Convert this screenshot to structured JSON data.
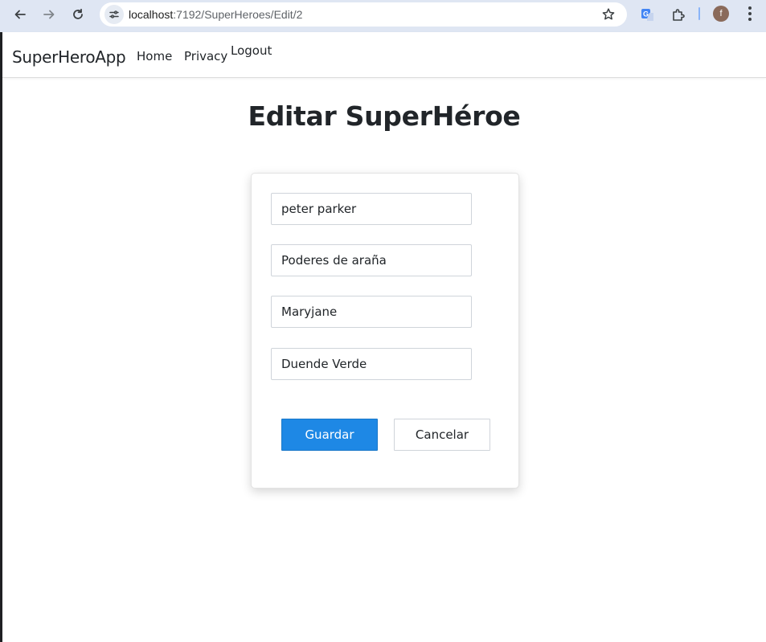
{
  "browser": {
    "url_host": "localhost",
    "url_path": ":7192/SuperHeroes/Edit/2",
    "profile_initial": "f",
    "icons": [
      "back-arrow-icon",
      "forward-arrow-icon",
      "reload-icon",
      "site-info-icon",
      "bookmark-star-icon",
      "translate-icon",
      "extensions-icon",
      "menu-dots-icon"
    ]
  },
  "navbar": {
    "brand": "SuperHeroApp",
    "links": [
      "Home",
      "Privacy",
      "Logout"
    ]
  },
  "page": {
    "title": "Editar SuperHéroe"
  },
  "form": {
    "fields": [
      {
        "value": "peter parker"
      },
      {
        "value": "Poderes de araña"
      },
      {
        "value": "Maryjane"
      },
      {
        "value": "Duende Verde"
      }
    ],
    "save_label": "Guardar",
    "cancel_label": "Cancelar"
  },
  "colors": {
    "primary": "#1e88e5",
    "chrome_bg": "#dfe6f3"
  }
}
